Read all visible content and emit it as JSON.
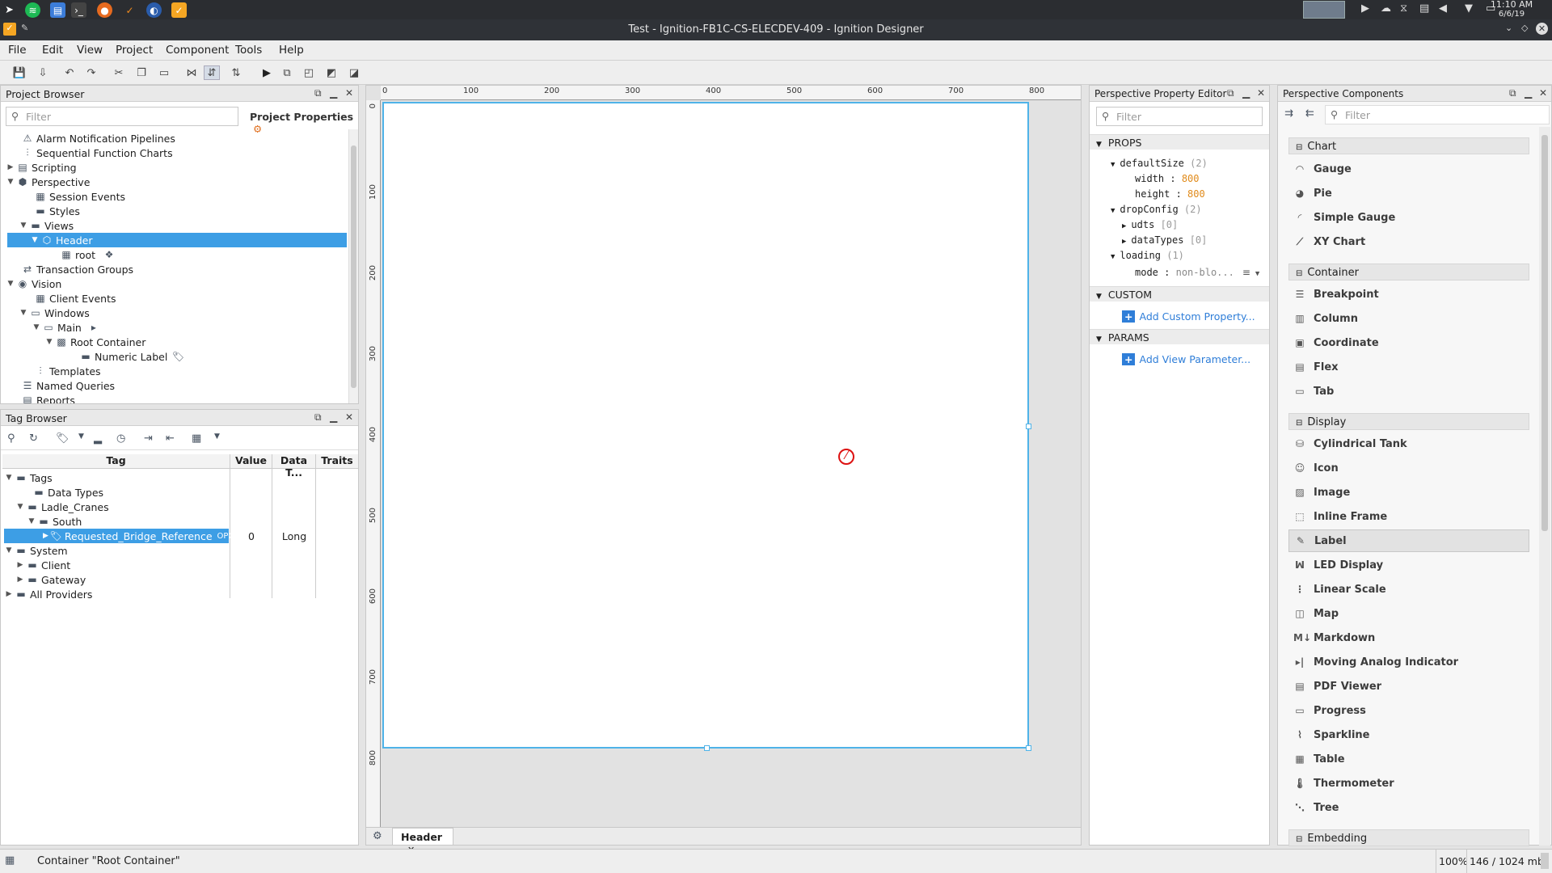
{
  "taskbar": {
    "time": "11:10 AM",
    "date": "6/6/19"
  },
  "window": {
    "title": "Test - Ignition-FB1C-CS-ELECDEV-409 - Ignition Designer"
  },
  "menu": {
    "items": [
      "File",
      "Edit",
      "View",
      "Project",
      "Component",
      "Tools",
      "Help"
    ]
  },
  "project_browser": {
    "title": "Project Browser",
    "filter_placeholder": "Filter",
    "properties_btn": "Project Properties",
    "items": [
      {
        "label": "Alarm Notification Pipelines"
      },
      {
        "label": "Sequential Function Charts"
      },
      {
        "label": "Scripting"
      },
      {
        "label": "Perspective"
      },
      {
        "label": "Session Events"
      },
      {
        "label": "Styles"
      },
      {
        "label": "Views"
      },
      {
        "label": "Header"
      },
      {
        "label": "root"
      },
      {
        "label": "Transaction Groups"
      },
      {
        "label": "Vision"
      },
      {
        "label": "Client Events"
      },
      {
        "label": "Windows"
      },
      {
        "label": "Main"
      },
      {
        "label": "Root Container"
      },
      {
        "label": "Numeric Label"
      },
      {
        "label": "Templates"
      },
      {
        "label": "Named Queries"
      },
      {
        "label": "Reports"
      }
    ]
  },
  "tag_browser": {
    "title": "Tag Browser",
    "columns": [
      "Tag",
      "Value",
      "Data T...",
      "Traits"
    ],
    "rows": [
      {
        "label": "Tags"
      },
      {
        "label": "Data Types"
      },
      {
        "label": "Ladle_Cranes"
      },
      {
        "label": "South"
      },
      {
        "label": "Requested_Bridge_Reference",
        "badge": "OPC",
        "value": "0",
        "type": "Long"
      },
      {
        "label": "System"
      },
      {
        "label": "Client"
      },
      {
        "label": "Gateway"
      },
      {
        "label": "All Providers"
      }
    ]
  },
  "canvas": {
    "ruler_h": [
      "0",
      "100",
      "200",
      "300",
      "400",
      "500",
      "600",
      "700",
      "800"
    ],
    "ruler_v": [
      "0",
      "100",
      "200",
      "300",
      "400",
      "500",
      "600",
      "700",
      "800"
    ],
    "tab_label": "Header"
  },
  "property_editor": {
    "title": "Perspective Property Editor",
    "filter_placeholder": "Filter",
    "sections": [
      "PROPS",
      "CUSTOM",
      "PARAMS"
    ],
    "props": {
      "defaultSize": "defaultSize",
      "defaultSize_count": "(2)",
      "width_key": "width",
      "width_val": "800",
      "height_key": "height",
      "height_val": "800",
      "dropConfig": "dropConfig",
      "dropConfig_count": "(2)",
      "udts": "udts",
      "udts_count": "[0]",
      "dataTypes": "dataTypes",
      "dataTypes_count": "[0]",
      "loading": "loading",
      "loading_count": "(1)",
      "mode_key": "mode",
      "mode_val": "non-blo..."
    },
    "add_custom": "Add Custom Property...",
    "add_param": "Add View Parameter..."
  },
  "components": {
    "title": "Perspective Components",
    "filter_placeholder": "Filter",
    "categories": {
      "chart": "Chart",
      "container": "Container",
      "display": "Display",
      "embedding": "Embedding"
    },
    "chart_items": [
      "Gauge",
      "Pie",
      "Simple Gauge",
      "XY Chart"
    ],
    "container_items": [
      "Breakpoint",
      "Column",
      "Coordinate",
      "Flex",
      "Tab"
    ],
    "display_items": [
      "Cylindrical Tank",
      "Icon",
      "Image",
      "Inline Frame",
      "Label",
      "LED Display",
      "Linear Scale",
      "Map",
      "Markdown",
      "Moving Analog Indicator",
      "PDF Viewer",
      "Progress",
      "Sparkline",
      "Table",
      "Thermometer",
      "Tree"
    ],
    "selected": "Label"
  },
  "status_bar": {
    "selection": "Container \"Root Container\"",
    "zoom": "100%",
    "memory": "146 / 1024 mb"
  }
}
